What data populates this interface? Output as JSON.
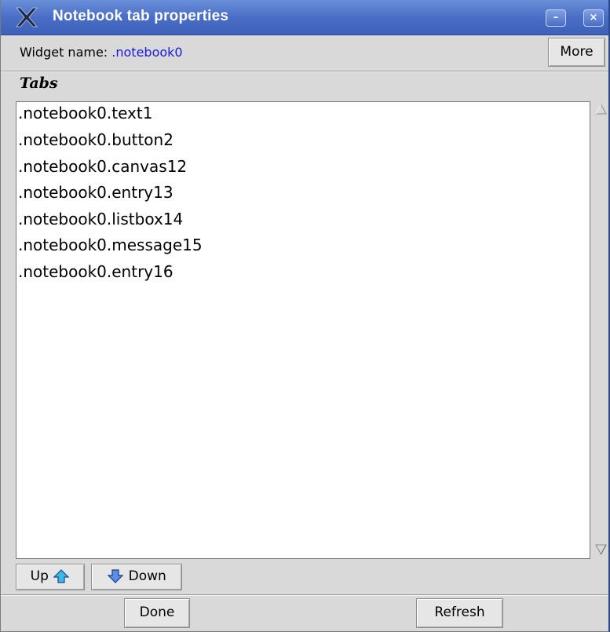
{
  "window": {
    "title": "Notebook tab properties",
    "minimize_label": "–",
    "close_label": "×"
  },
  "widget": {
    "label": "Widget name: ",
    "name": ".notebook0",
    "more_label": "More"
  },
  "tabs": {
    "title": "Tabs",
    "items": [
      ".notebook0.text1",
      ".notebook0.button2",
      ".notebook0.canvas12",
      ".notebook0.entry13",
      ".notebook0.listbox14",
      ".notebook0.message15",
      ".notebook0.entry16"
    ]
  },
  "buttons": {
    "up_label": "Up",
    "down_label": "Down",
    "done_label": "Done",
    "refresh_label": "Refresh"
  },
  "icons": {
    "app": "x-logo-icon",
    "up": "up-arrow-icon",
    "down": "down-arrow-icon",
    "accent": "#4a6ec6"
  }
}
